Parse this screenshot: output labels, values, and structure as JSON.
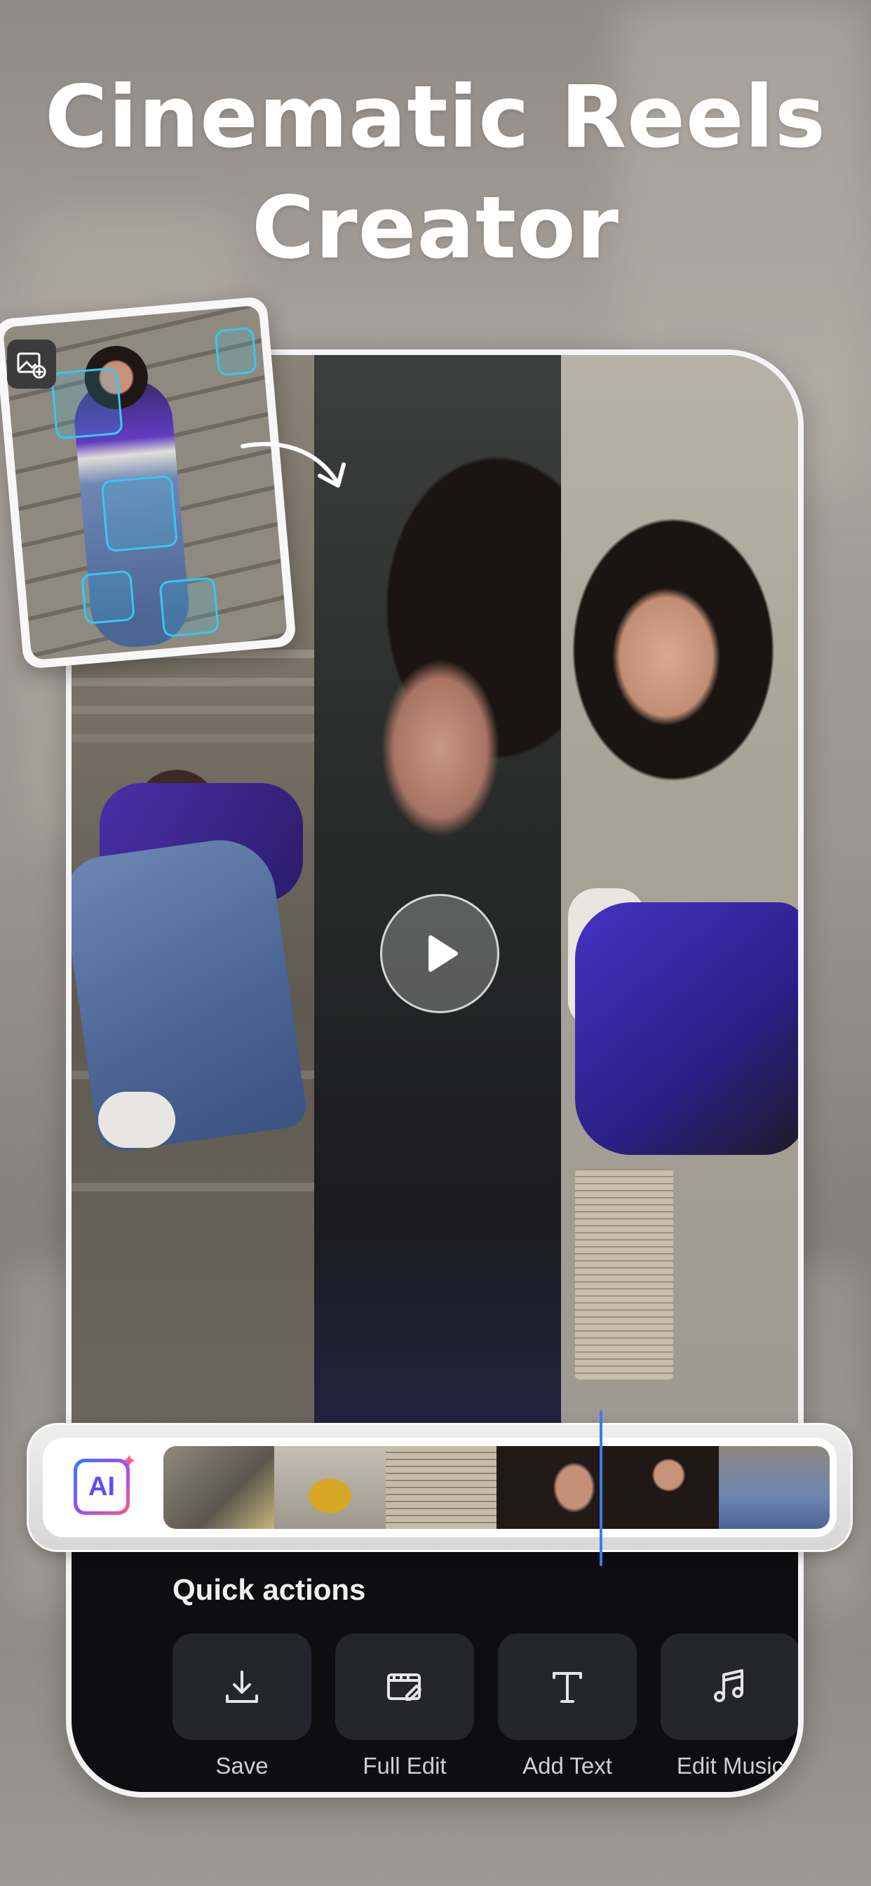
{
  "headline": {
    "line1": "Cinematic Reels",
    "line2": "Creator"
  },
  "player": {
    "play_icon": "play-icon"
  },
  "source_card": {
    "icon": "add-photo-icon"
  },
  "timeline": {
    "ai_badge_label": "AI",
    "thumbnail_count": 6
  },
  "quick_actions": {
    "title": "Quick actions",
    "items": [
      {
        "label": "Save",
        "icon": "download-icon"
      },
      {
        "label": "Full Edit",
        "icon": "edit-clip-icon"
      },
      {
        "label": "Add Text",
        "icon": "text-icon"
      },
      {
        "label": "Edit Music",
        "icon": "music-note-icon"
      }
    ]
  },
  "colors": {
    "accent_blue": "#3d7be8",
    "focus_cyan": "#38c7f0",
    "quick_actions_bg": "#0e0e10",
    "card_bg": "#25262b"
  }
}
